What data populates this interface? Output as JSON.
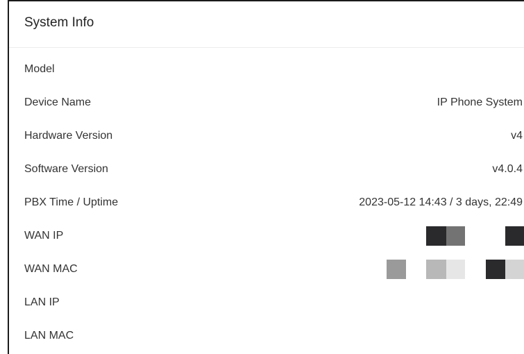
{
  "panel": {
    "title": "System Info"
  },
  "rows": [
    {
      "label": "Model",
      "value": ""
    },
    {
      "label": "Device Name",
      "value": "IP Phone System"
    },
    {
      "label": "Hardware Version",
      "value": "v4"
    },
    {
      "label": "Software Version",
      "value": "v4.0.4"
    },
    {
      "label": "PBX Time / Uptime",
      "value": "2023-05-12 14:43 / 3 days, 22:49"
    },
    {
      "label": "WAN IP",
      "value": ""
    },
    {
      "label": "WAN MAC",
      "value": ""
    },
    {
      "label": "LAN IP",
      "value": ""
    },
    {
      "label": "LAN MAC",
      "value": ""
    }
  ],
  "colors": {
    "mosaic_dark": "#2a2a2d",
    "mosaic_mid": "#737373",
    "mosaic_gray": "#9a9a9a",
    "mosaic_light": "#b8b8b8",
    "mosaic_lighter": "#e6e6e6",
    "mosaic_pale": "#d4d4d4"
  }
}
